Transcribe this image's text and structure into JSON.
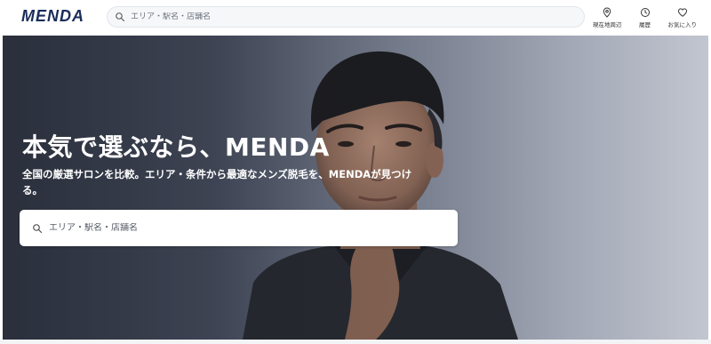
{
  "header": {
    "logo": "MENDA",
    "search": {
      "placeholder": "エリア・駅名・店舗名",
      "value": ""
    },
    "actions": [
      {
        "label": "現在地周辺",
        "icon": "location-pin-icon"
      },
      {
        "label": "履歴",
        "icon": "clock-icon"
      },
      {
        "label": "お気に入り",
        "icon": "heart-icon"
      }
    ]
  },
  "hero": {
    "title": "本気で選ぶなら、MENDA",
    "subtitle": "全国の厳選サロンを比較。エリア・条件から最適なメンズ脱毛を、MENDAが見つける。",
    "search": {
      "placeholder": "エリア・駅名・店舗名",
      "value": ""
    },
    "image": "man-portrait"
  },
  "colors": {
    "brand": "#1a2d5a",
    "hero_text": "#ffffff",
    "hero_overlay": "#3a4050"
  }
}
